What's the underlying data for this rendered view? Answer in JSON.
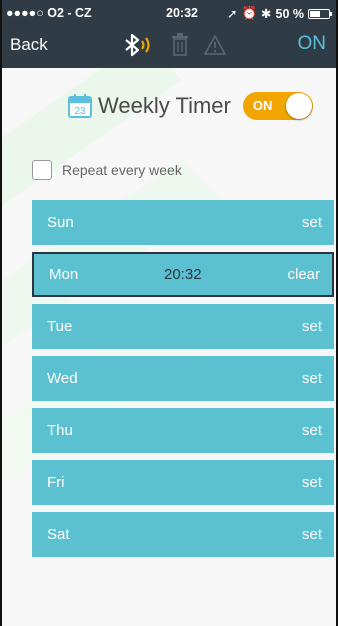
{
  "status_bar": {
    "carrier": "●●●●○ O2 - CZ",
    "time": "20:32",
    "battery": "50 %"
  },
  "nav": {
    "back_label": "Back",
    "on_label": "ON"
  },
  "title": {
    "calendar_day": "23",
    "text": "Weekly Timer",
    "toggle_label": "ON"
  },
  "repeat": {
    "label": "Repeat every week",
    "checked": false
  },
  "days": [
    {
      "name": "Sun",
      "time": "",
      "action": "set"
    },
    {
      "name": "Mon",
      "time": "20:32",
      "action": "clear"
    },
    {
      "name": "Tue",
      "time": "",
      "action": "set"
    },
    {
      "name": "Wed",
      "time": "",
      "action": "set"
    },
    {
      "name": "Thu",
      "time": "",
      "action": "set"
    },
    {
      "name": "Fri",
      "time": "",
      "action": "set"
    },
    {
      "name": "Sat",
      "time": "",
      "action": "set"
    }
  ],
  "colors": {
    "header_bg": "#2f3b45",
    "accent_blue": "#5bc0de",
    "toggle_orange": "#f0a500",
    "row_bg": "#5bc0d0",
    "selected_border": "#2a3540"
  }
}
